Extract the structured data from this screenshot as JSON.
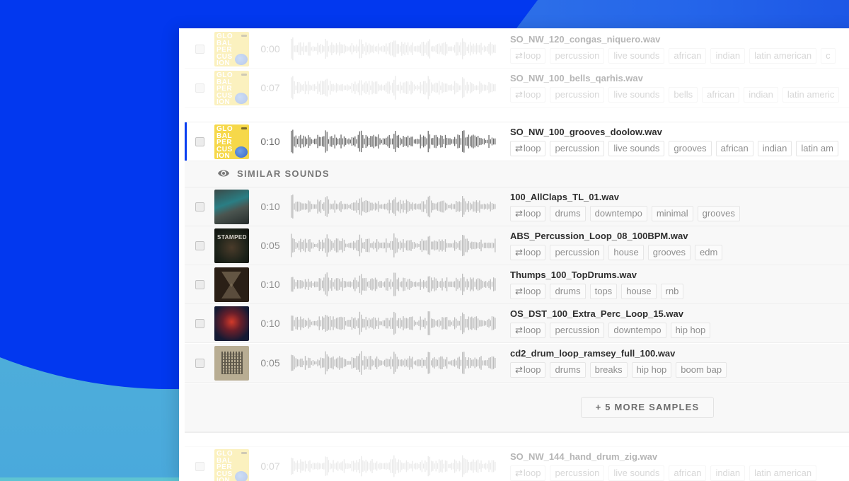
{
  "colors": {
    "accent": "#0b3ff0",
    "background_blue": "#0238ef",
    "background_teal": "#5ec4d2",
    "tag_text": "#8e8e8e",
    "filename_text": "#2e2e2e"
  },
  "samples_before": [
    {
      "filename": "SO_NW_120_congas_niquero.wav",
      "duration": "0:00",
      "cover": "GLO\nBAL\nPER\nCUS\nION",
      "tags": [
        "loop",
        "percussion",
        "live sounds",
        "african",
        "indian",
        "latin american",
        "c"
      ]
    },
    {
      "filename": "SO_NW_100_bells_qarhis.wav",
      "duration": "0:07",
      "cover": "GLO\nBAL\nPER\nCUS\nION",
      "tags": [
        "loop",
        "percussion",
        "live sounds",
        "bells",
        "african",
        "indian",
        "latin americ"
      ]
    }
  ],
  "active_sample": {
    "filename": "SO_NW_100_grooves_doolow.wav",
    "duration": "0:10",
    "cover": "GLO\nBAL\nPER\nCUS\nION",
    "tags": [
      "loop",
      "percussion",
      "live sounds",
      "grooves",
      "african",
      "indian",
      "latin am"
    ]
  },
  "similar_header": {
    "icon": "eye-icon",
    "label": "SIMILAR SOUNDS"
  },
  "similar_sounds": [
    {
      "filename": "100_AllClaps_TL_01.wav",
      "duration": "0:10",
      "tags": [
        "loop",
        "drums",
        "downtempo",
        "minimal",
        "grooves"
      ]
    },
    {
      "filename": "ABS_Percussion_Loop_08_100BPM.wav",
      "duration": "0:05",
      "cover_text": "STAMPED",
      "tags": [
        "loop",
        "percussion",
        "house",
        "grooves",
        "edm"
      ]
    },
    {
      "filename": "Thumps_100_TopDrums.wav",
      "duration": "0:10",
      "tags": [
        "loop",
        "drums",
        "tops",
        "house",
        "rnb"
      ]
    },
    {
      "filename": "OS_DST_100_Extra_Perc_Loop_15.wav",
      "duration": "0:10",
      "tags": [
        "loop",
        "percussion",
        "downtempo",
        "hip hop"
      ]
    },
    {
      "filename": "cd2_drum_loop_ramsey_full_100.wav",
      "duration": "0:05",
      "tags": [
        "loop",
        "drums",
        "breaks",
        "hip hop",
        "boom bap"
      ]
    }
  ],
  "more_button": {
    "label": "+ 5 MORE SAMPLES"
  },
  "samples_after": [
    {
      "filename": "SO_NW_144_hand_drum_zig.wav",
      "duration": "0:07",
      "cover": "GLO\nBAL\nPER\nCUS\nION",
      "tags": [
        "loop",
        "percussion",
        "live sounds",
        "african",
        "indian",
        "latin american"
      ]
    }
  ]
}
